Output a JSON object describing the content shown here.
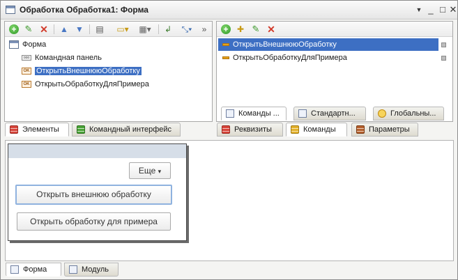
{
  "window": {
    "title": "Обработка Обработка1: Форма",
    "controls": {
      "menu": "▼",
      "minimize": "_",
      "maximize": "□",
      "close": "✕"
    }
  },
  "left_panel": {
    "tree": [
      {
        "label": "Форма",
        "icon": "form-icon"
      },
      {
        "label": "Командная панель",
        "icon": "command-bar-icon"
      },
      {
        "label": "ОткрытьВнешнююОбработку",
        "icon": "ok-icon",
        "selected": true
      },
      {
        "label": "ОткрытьОбработкуДляПримера",
        "icon": "ok-icon"
      }
    ],
    "icon_ok_text": "OK",
    "icon_cmd_text": "ooo",
    "tabs": [
      "Элементы",
      "Командный интерфейс"
    ]
  },
  "right_panel": {
    "commands": [
      {
        "label": "ОткрытьВнешнююОбработку",
        "selected": true
      },
      {
        "label": "ОткрытьОбработкуДляПримера"
      }
    ],
    "subtabs": [
      "Команды ...",
      "Стандартн...",
      "Глобальны..."
    ],
    "tabs": [
      "Реквизиты",
      "Команды",
      "Параметры"
    ]
  },
  "preview": {
    "more_button": "Еще",
    "more_arrow": "▾",
    "buttons": [
      "Открыть внешнюю обработку",
      "Открыть обработку для примера"
    ]
  },
  "bottom_tabs": [
    "Форма",
    "Модуль"
  ],
  "colors": {
    "selection": "#3d6fc3",
    "accent": "#8fb2df"
  }
}
